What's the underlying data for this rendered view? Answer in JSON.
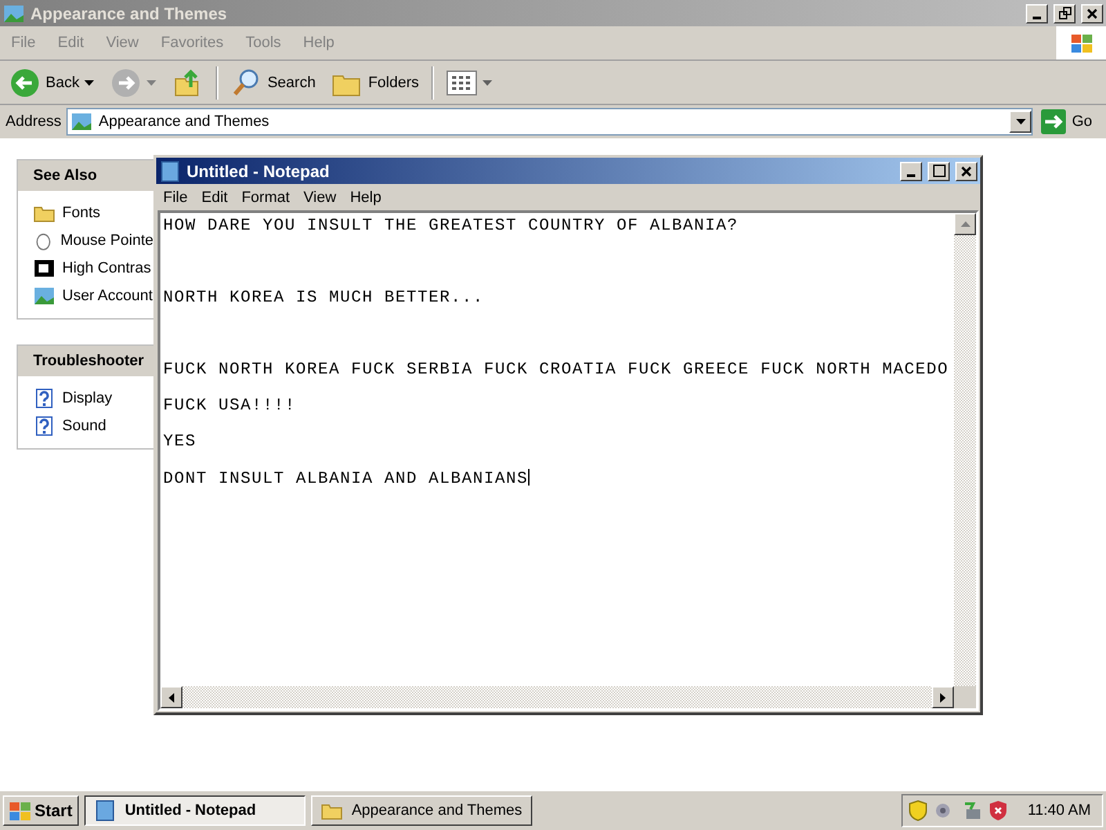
{
  "explorer": {
    "title": "Appearance and Themes",
    "active": false,
    "menu": [
      "File",
      "Edit",
      "View",
      "Favorites",
      "Tools",
      "Help"
    ],
    "toolbar": {
      "back": "Back",
      "search": "Search",
      "folders": "Folders"
    },
    "address": {
      "label": "Address",
      "value": "Appearance and Themes",
      "go": "Go"
    },
    "panels": [
      {
        "title": "See Also",
        "items": [
          {
            "label": "Fonts",
            "kind": "folder"
          },
          {
            "label": "Mouse Pointe",
            "kind": "mouse"
          },
          {
            "label": "High Contras",
            "kind": "contrast"
          },
          {
            "label": "User Account",
            "kind": "picture"
          }
        ]
      },
      {
        "title": "Troubleshooter",
        "items": [
          {
            "label": "Display",
            "kind": "help"
          },
          {
            "label": "Sound",
            "kind": "help"
          }
        ]
      }
    ]
  },
  "notepad": {
    "title": "Untitled - Notepad",
    "active": true,
    "menu": [
      "File",
      "Edit",
      "Format",
      "View",
      "Help"
    ],
    "text": "HOW DARE YOU INSULT THE GREATEST COUNTRY OF ALBANIA?\n\n\n\nNORTH KOREA IS MUCH BETTER...\n\n\n\nFUCK NORTH KOREA FUCK SERBIA FUCK CROATIA FUCK GREECE FUCK NORTH MACEDO\n\nFUCK USA!!!!\n\nYES\n\nDONT INSULT ALBANIA AND ALBANIANS"
  },
  "taskbar": {
    "start": "Start",
    "buttons": [
      {
        "label": "Untitled - Notepad",
        "selected": true,
        "kind": "notepad"
      },
      {
        "label": "Appearance and Themes",
        "selected": false,
        "kind": "folder"
      }
    ],
    "clock": "11:40 AM"
  }
}
